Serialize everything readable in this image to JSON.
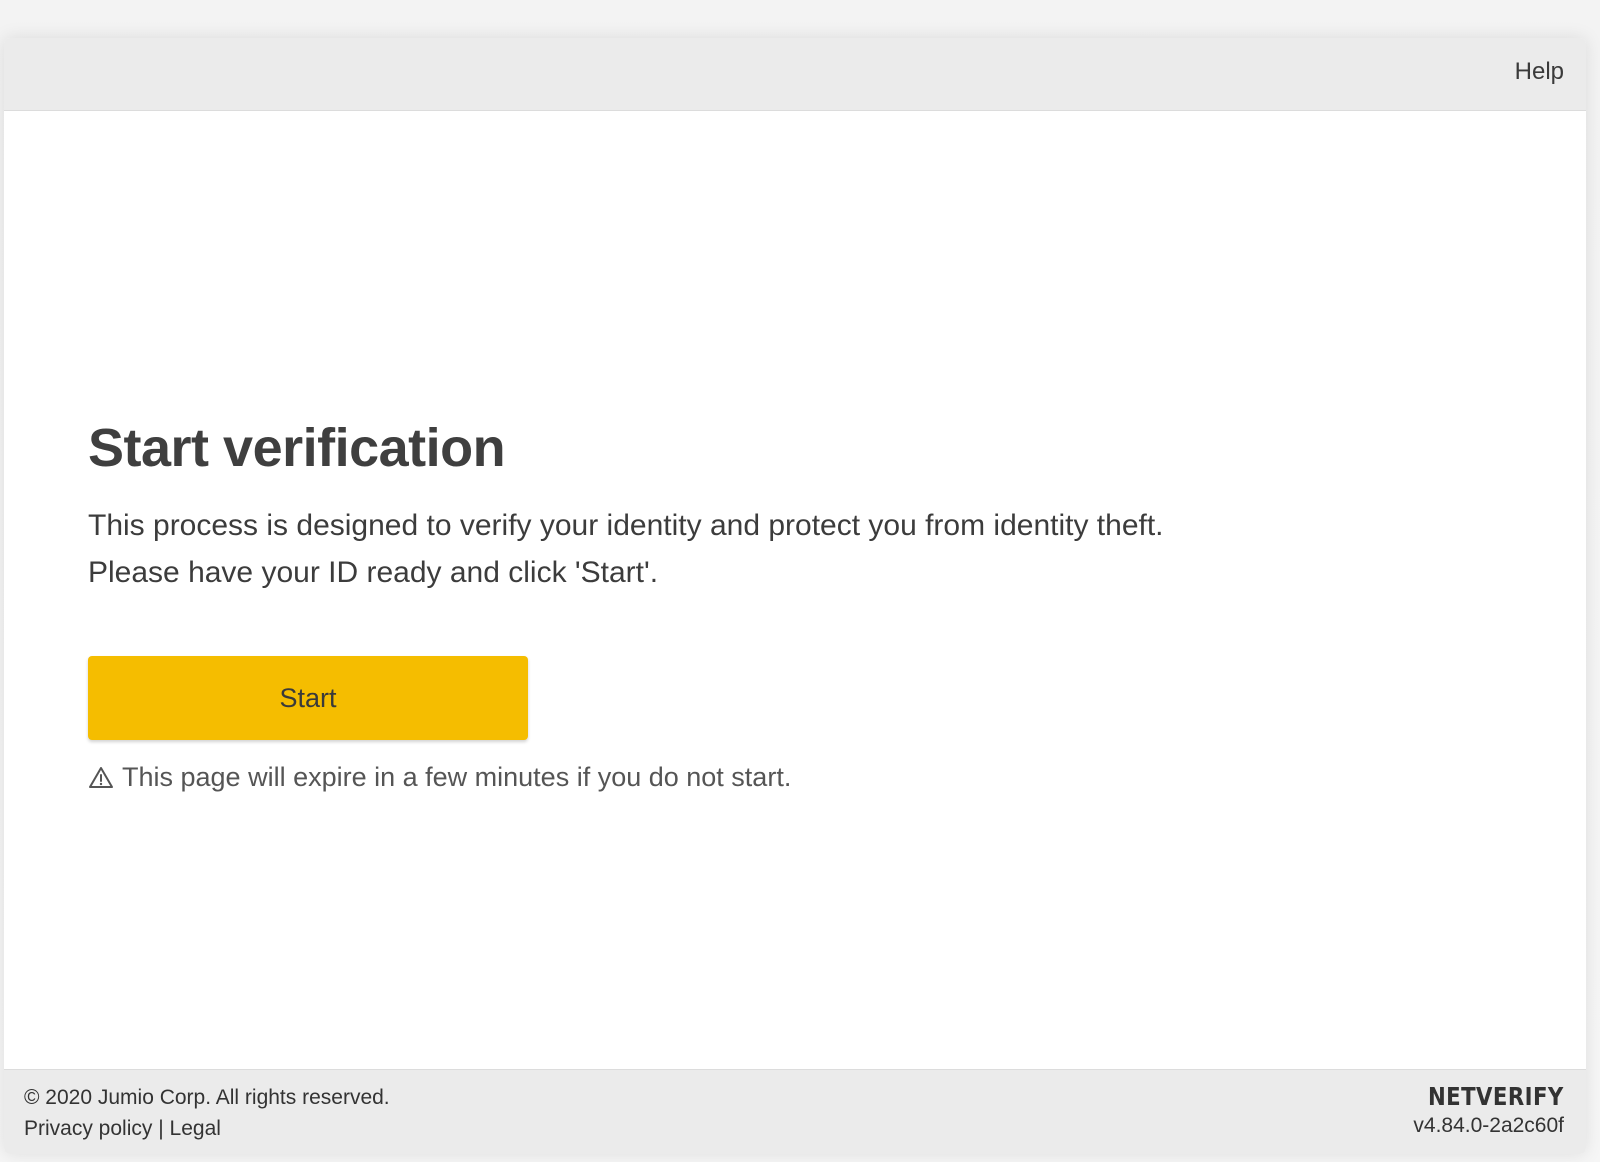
{
  "header": {
    "help_label": "Help"
  },
  "main": {
    "title": "Start verification",
    "description_line1": "This process is designed to verify your identity and protect you from identity theft.",
    "description_line2": "Please have your ID ready and click 'Start'.",
    "start_button_label": "Start",
    "expire_notice": "This page will expire in a few minutes if you do not start.",
    "warning_icon": "warning-triangle-icon"
  },
  "footer": {
    "copyright": "© 2020 Jumio Corp. All rights reserved.",
    "privacy_label": "Privacy policy",
    "separator": "|",
    "legal_label": "Legal",
    "brand": "NETVERIFY",
    "version": "v4.84.0-2a2c60f"
  },
  "colors": {
    "accent": "#f5bd00",
    "bar_background": "#ebebeb",
    "text": "#3f3f3f"
  }
}
